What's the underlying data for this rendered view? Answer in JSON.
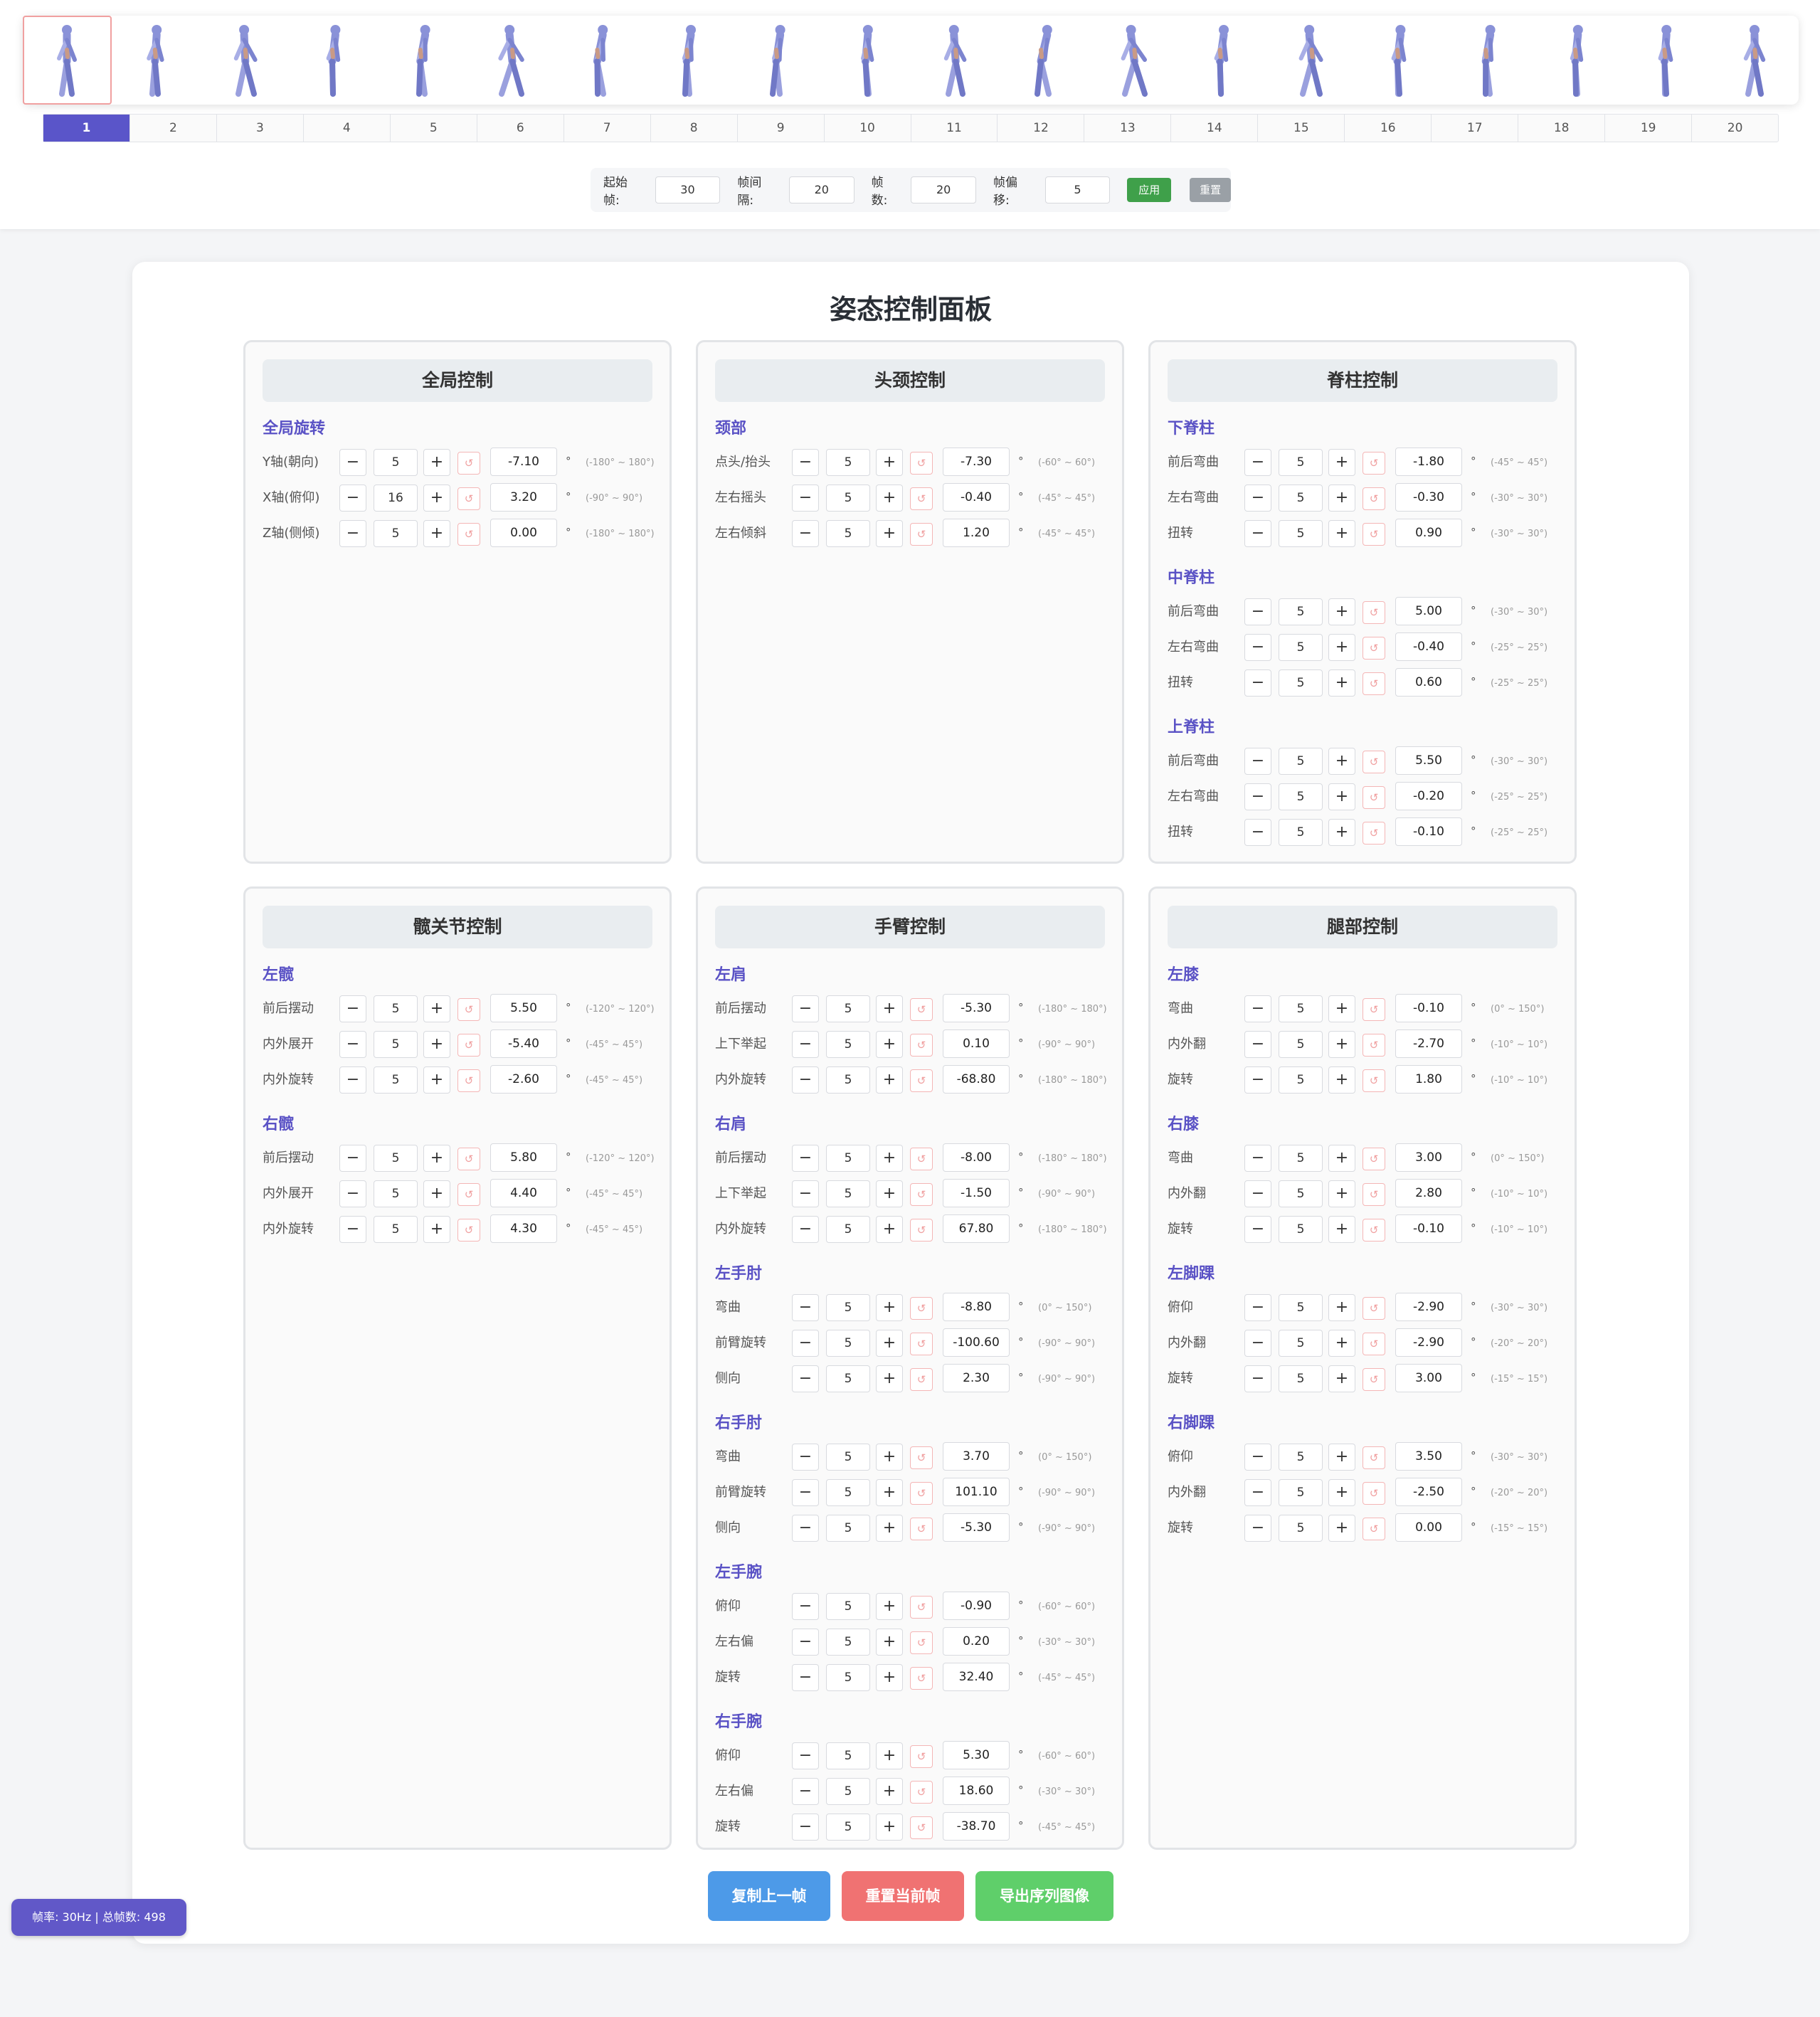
{
  "frames": {
    "count": 20,
    "active_index": 0,
    "pages": [
      "1",
      "2",
      "3",
      "4",
      "5",
      "6",
      "7",
      "8",
      "9",
      "10",
      "11",
      "12",
      "13",
      "14",
      "15",
      "16",
      "17",
      "18",
      "19",
      "20"
    ]
  },
  "settings": {
    "start_label": "起始帧:",
    "start_value": "30",
    "interval_label": "帧间隔:",
    "interval_value": "20",
    "count_label": "帧数:",
    "count_value": "20",
    "offset_label": "帧偏移:",
    "offset_value": "5",
    "apply_label": "应用",
    "reset_label": "重置"
  },
  "panel_title": "姿态控制面板",
  "controls": {
    "minus": "−",
    "plus": "+",
    "reset_icon": "↺",
    "degree": "°"
  },
  "cards": [
    {
      "title": "全局控制",
      "sections": [
        {
          "name": "全局旋转",
          "rows": [
            {
              "label": "Y轴(朝向)",
              "step": "5",
              "value": "-7.10",
              "range": "(-180° ~ 180°)"
            },
            {
              "label": "X轴(俯仰)",
              "step": "16",
              "value": "3.20",
              "range": "(-90° ~ 90°)"
            },
            {
              "label": "Z轴(侧倾)",
              "step": "5",
              "value": "0.00",
              "range": "(-180° ~ 180°)"
            }
          ]
        }
      ]
    },
    {
      "title": "头颈控制",
      "sections": [
        {
          "name": "颈部",
          "rows": [
            {
              "label": "点头/抬头",
              "step": "5",
              "value": "-7.30",
              "range": "(-60° ~ 60°)"
            },
            {
              "label": "左右摇头",
              "step": "5",
              "value": "-0.40",
              "range": "(-45° ~ 45°)"
            },
            {
              "label": "左右倾斜",
              "step": "5",
              "value": "1.20",
              "range": "(-45° ~ 45°)"
            }
          ]
        }
      ]
    },
    {
      "title": "脊柱控制",
      "sections": [
        {
          "name": "下脊柱",
          "rows": [
            {
              "label": "前后弯曲",
              "step": "5",
              "value": "-1.80",
              "range": "(-45° ~ 45°)"
            },
            {
              "label": "左右弯曲",
              "step": "5",
              "value": "-0.30",
              "range": "(-30° ~ 30°)"
            },
            {
              "label": "扭转",
              "step": "5",
              "value": "0.90",
              "range": "(-30° ~ 30°)"
            }
          ]
        },
        {
          "name": "中脊柱",
          "rows": [
            {
              "label": "前后弯曲",
              "step": "5",
              "value": "5.00",
              "range": "(-30° ~ 30°)"
            },
            {
              "label": "左右弯曲",
              "step": "5",
              "value": "-0.40",
              "range": "(-25° ~ 25°)"
            },
            {
              "label": "扭转",
              "step": "5",
              "value": "0.60",
              "range": "(-25° ~ 25°)"
            }
          ]
        },
        {
          "name": "上脊柱",
          "rows": [
            {
              "label": "前后弯曲",
              "step": "5",
              "value": "5.50",
              "range": "(-30° ~ 30°)"
            },
            {
              "label": "左右弯曲",
              "step": "5",
              "value": "-0.20",
              "range": "(-25° ~ 25°)"
            },
            {
              "label": "扭转",
              "step": "5",
              "value": "-0.10",
              "range": "(-25° ~ 25°)"
            }
          ]
        }
      ]
    },
    {
      "title": "髋关节控制",
      "sections": [
        {
          "name": "左髋",
          "rows": [
            {
              "label": "前后摆动",
              "step": "5",
              "value": "5.50",
              "range": "(-120° ~ 120°)"
            },
            {
              "label": "内外展开",
              "step": "5",
              "value": "-5.40",
              "range": "(-45° ~ 45°)"
            },
            {
              "label": "内外旋转",
              "step": "5",
              "value": "-2.60",
              "range": "(-45° ~ 45°)"
            }
          ]
        },
        {
          "name": "右髋",
          "rows": [
            {
              "label": "前后摆动",
              "step": "5",
              "value": "5.80",
              "range": "(-120° ~ 120°)"
            },
            {
              "label": "内外展开",
              "step": "5",
              "value": "4.40",
              "range": "(-45° ~ 45°)"
            },
            {
              "label": "内外旋转",
              "step": "5",
              "value": "4.30",
              "range": "(-45° ~ 45°)"
            }
          ]
        }
      ]
    },
    {
      "title": "手臂控制",
      "sections": [
        {
          "name": "左肩",
          "rows": [
            {
              "label": "前后摆动",
              "step": "5",
              "value": "-5.30",
              "range": "(-180° ~ 180°)"
            },
            {
              "label": "上下举起",
              "step": "5",
              "value": "0.10",
              "range": "(-90° ~ 90°)"
            },
            {
              "label": "内外旋转",
              "step": "5",
              "value": "-68.80",
              "range": "(-180° ~ 180°)"
            }
          ]
        },
        {
          "name": "右肩",
          "rows": [
            {
              "label": "前后摆动",
              "step": "5",
              "value": "-8.00",
              "range": "(-180° ~ 180°)"
            },
            {
              "label": "上下举起",
              "step": "5",
              "value": "-1.50",
              "range": "(-90° ~ 90°)"
            },
            {
              "label": "内外旋转",
              "step": "5",
              "value": "67.80",
              "range": "(-180° ~ 180°)"
            }
          ]
        },
        {
          "name": "左手肘",
          "rows": [
            {
              "label": "弯曲",
              "step": "5",
              "value": "-8.80",
              "range": "(0° ~ 150°)"
            },
            {
              "label": "前臂旋转",
              "step": "5",
              "value": "-100.60",
              "range": "(-90° ~ 90°)"
            },
            {
              "label": "侧向",
              "step": "5",
              "value": "2.30",
              "range": "(-90° ~ 90°)"
            }
          ]
        },
        {
          "name": "右手肘",
          "rows": [
            {
              "label": "弯曲",
              "step": "5",
              "value": "3.70",
              "range": "(0° ~ 150°)"
            },
            {
              "label": "前臂旋转",
              "step": "5",
              "value": "101.10",
              "range": "(-90° ~ 90°)"
            },
            {
              "label": "侧向",
              "step": "5",
              "value": "-5.30",
              "range": "(-90° ~ 90°)"
            }
          ]
        },
        {
          "name": "左手腕",
          "rows": [
            {
              "label": "俯仰",
              "step": "5",
              "value": "-0.90",
              "range": "(-60° ~ 60°)"
            },
            {
              "label": "左右偏",
              "step": "5",
              "value": "0.20",
              "range": "(-30° ~ 30°)"
            },
            {
              "label": "旋转",
              "step": "5",
              "value": "32.40",
              "range": "(-45° ~ 45°)"
            }
          ]
        },
        {
          "name": "右手腕",
          "rows": [
            {
              "label": "俯仰",
              "step": "5",
              "value": "5.30",
              "range": "(-60° ~ 60°)"
            },
            {
              "label": "左右偏",
              "step": "5",
              "value": "18.60",
              "range": "(-30° ~ 30°)"
            },
            {
              "label": "旋转",
              "step": "5",
              "value": "-38.70",
              "range": "(-45° ~ 45°)"
            }
          ]
        }
      ]
    },
    {
      "title": "腿部控制",
      "sections": [
        {
          "name": "左膝",
          "rows": [
            {
              "label": "弯曲",
              "step": "5",
              "value": "-0.10",
              "range": "(0° ~ 150°)"
            },
            {
              "label": "内外翻",
              "step": "5",
              "value": "-2.70",
              "range": "(-10° ~ 10°)"
            },
            {
              "label": "旋转",
              "step": "5",
              "value": "1.80",
              "range": "(-10° ~ 10°)"
            }
          ]
        },
        {
          "name": "右膝",
          "rows": [
            {
              "label": "弯曲",
              "step": "5",
              "value": "3.00",
              "range": "(0° ~ 150°)"
            },
            {
              "label": "内外翻",
              "step": "5",
              "value": "2.80",
              "range": "(-10° ~ 10°)"
            },
            {
              "label": "旋转",
              "step": "5",
              "value": "-0.10",
              "range": "(-10° ~ 10°)"
            }
          ]
        },
        {
          "name": "左脚踝",
          "rows": [
            {
              "label": "俯仰",
              "step": "5",
              "value": "-2.90",
              "range": "(-30° ~ 30°)"
            },
            {
              "label": "内外翻",
              "step": "5",
              "value": "-2.90",
              "range": "(-20° ~ 20°)"
            },
            {
              "label": "旋转",
              "step": "5",
              "value": "3.00",
              "range": "(-15° ~ 15°)"
            }
          ]
        },
        {
          "name": "右脚踝",
          "rows": [
            {
              "label": "俯仰",
              "step": "5",
              "value": "3.50",
              "range": "(-30° ~ 30°)"
            },
            {
              "label": "内外翻",
              "step": "5",
              "value": "-2.50",
              "range": "(-20° ~ 20°)"
            },
            {
              "label": "旋转",
              "step": "5",
              "value": "0.00",
              "range": "(-15° ~ 15°)"
            }
          ]
        }
      ]
    }
  ],
  "actions": {
    "copy_prev": "复制上一帧",
    "reset_current": "重置当前帧",
    "export_images": "导出序列图像"
  },
  "status": "帧率: 30Hz | 总帧数: 498",
  "colors": {
    "accent": "#5a55c9",
    "apply": "#3fa04a",
    "copy": "#4d9ae8",
    "reset": "#f07272",
    "export": "#5fcf6a",
    "figure": "#8a92d8"
  }
}
